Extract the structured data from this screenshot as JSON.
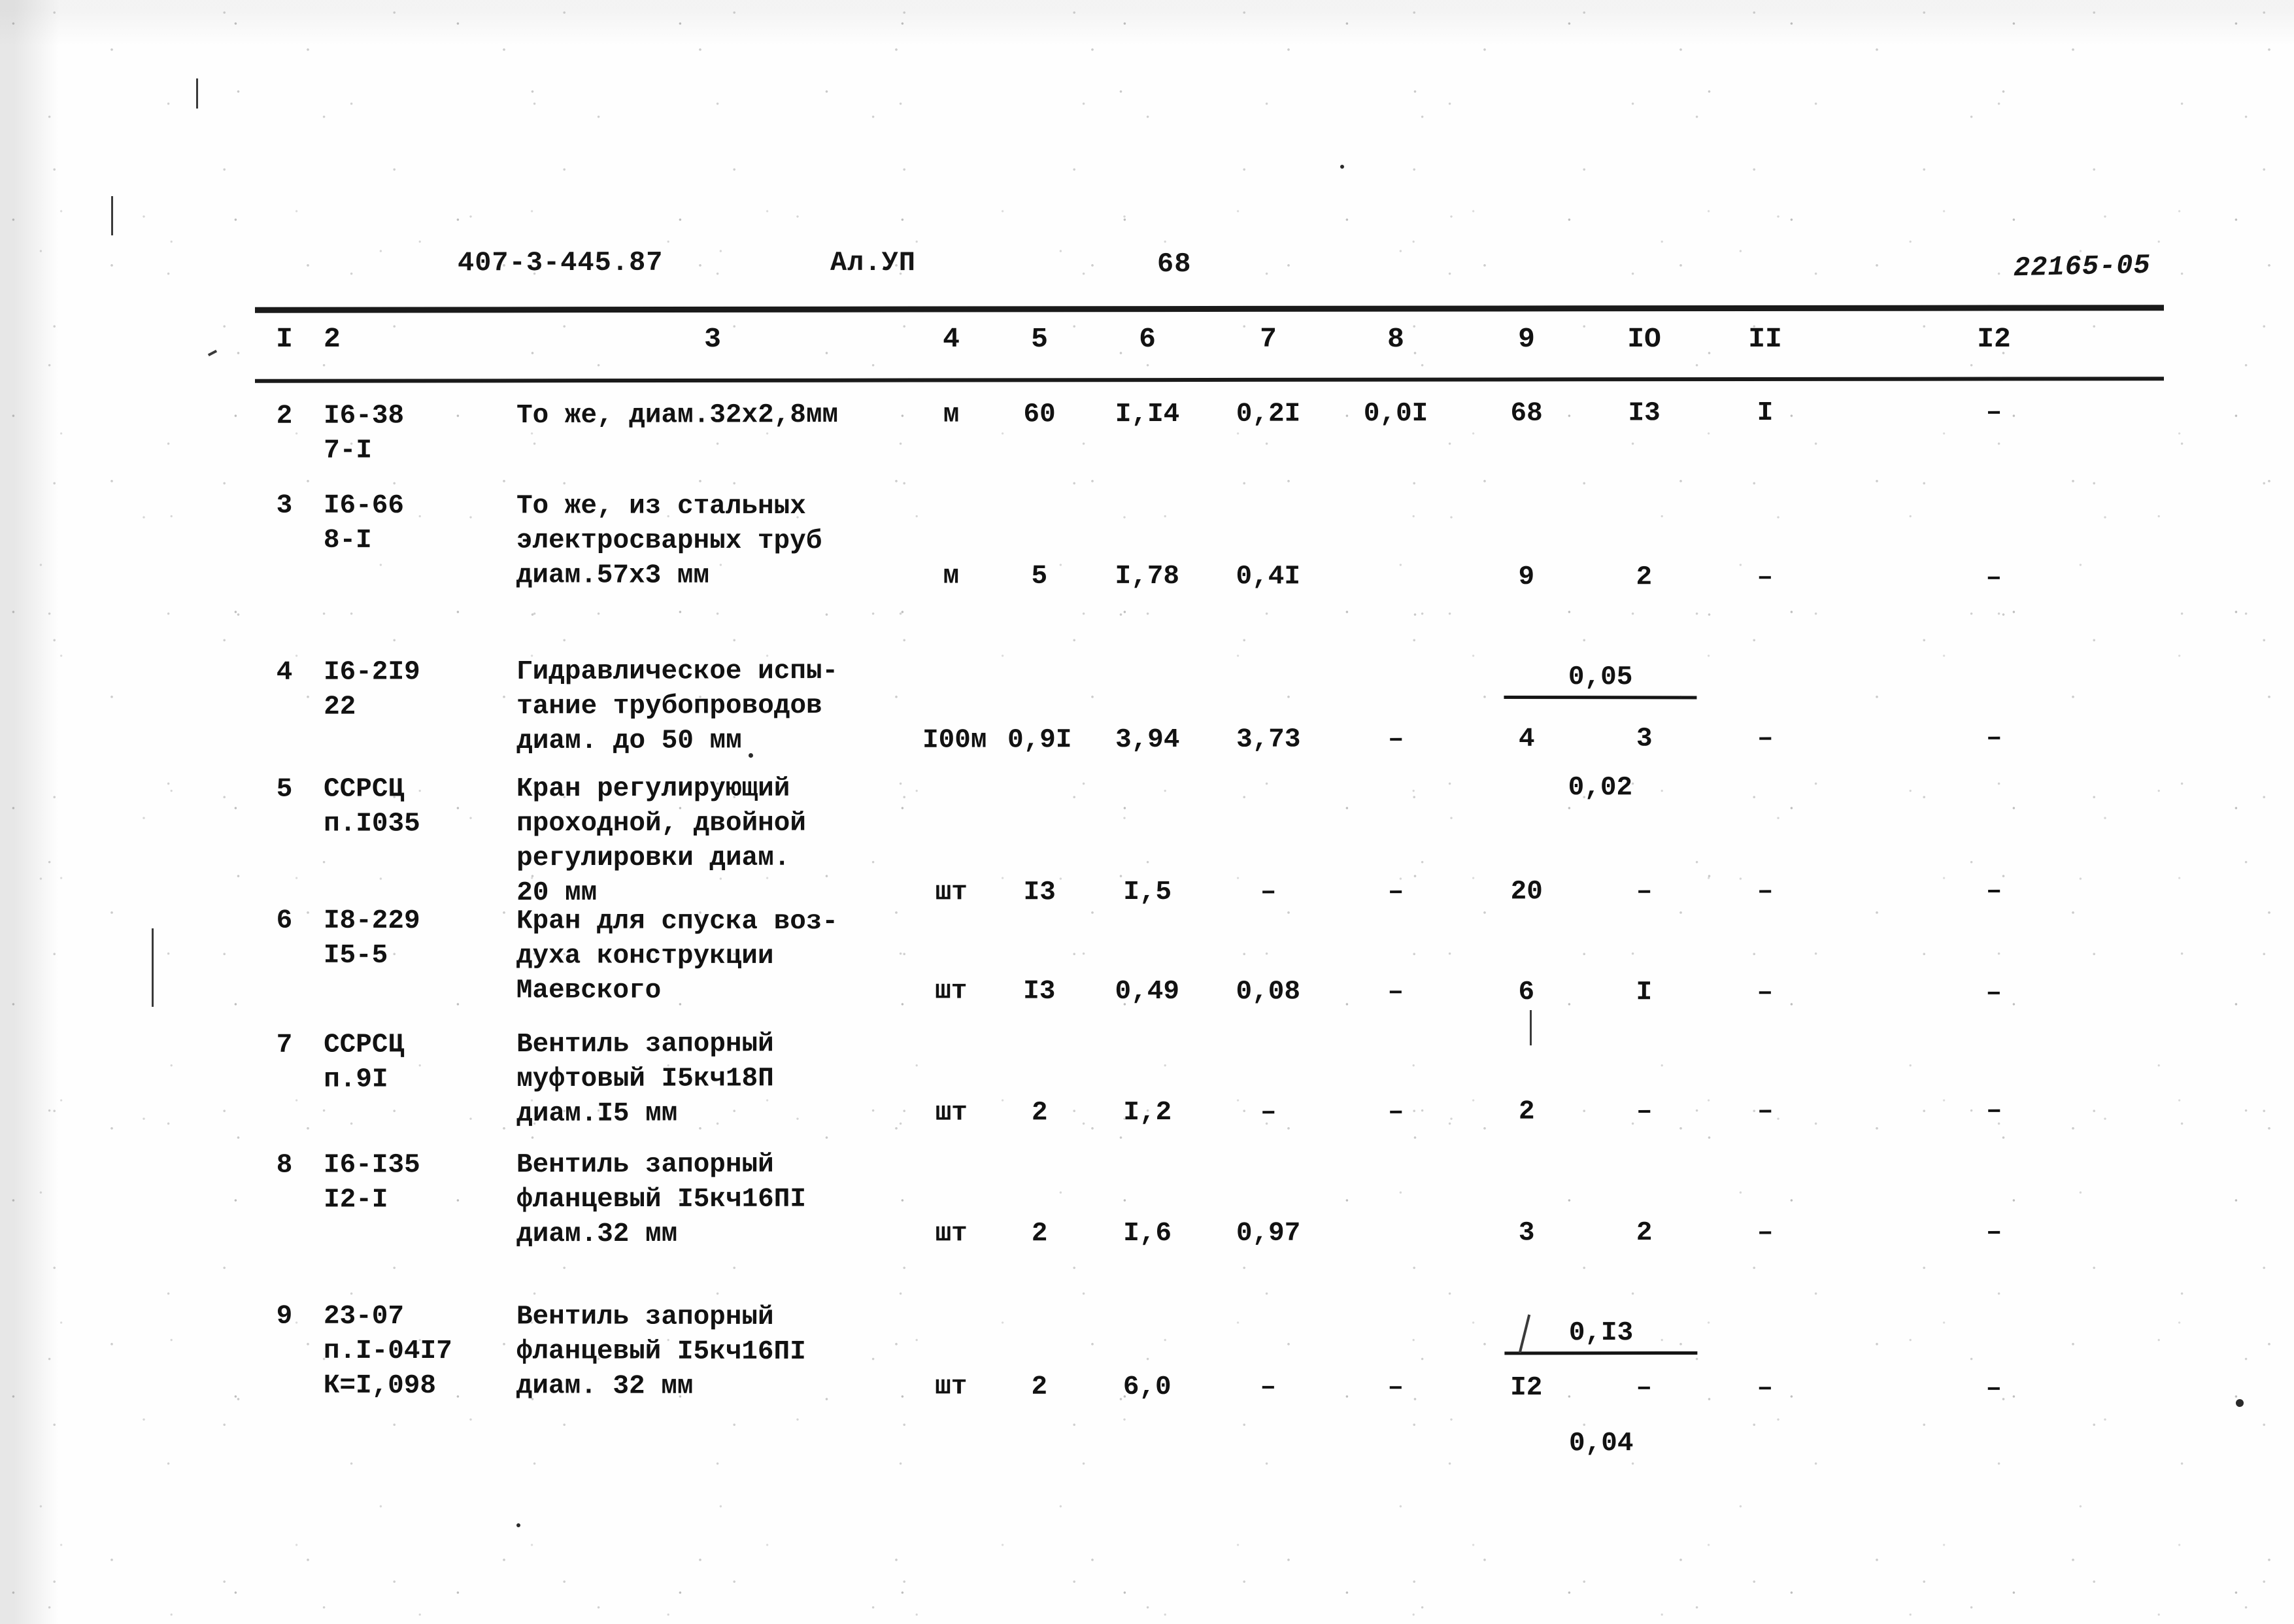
{
  "document": {
    "project_code": "407-3-445.87",
    "album": "Ал.УП",
    "page_number": "68",
    "archive_stamp": "22165-05"
  },
  "table": {
    "column_headers": [
      "I",
      "2",
      "3",
      "4",
      "5",
      "6",
      "7",
      "8",
      "9",
      "IO",
      "II",
      "I2"
    ],
    "rows": [
      {
        "no": "2",
        "code": "I6-38\n7-I",
        "name": "То же, диам.32х2,8мм",
        "unit": "м",
        "qty": "60",
        "c6": "I,I4",
        "c7": "0,2I",
        "c8": "0,0I",
        "c8_top": "",
        "c8_bot": "",
        "c9": "68",
        "c10": "I3",
        "c11": "I",
        "c12": "–"
      },
      {
        "no": "3",
        "code": "I6-66\n8-I",
        "name": "То же, из стальных\nэлектросварных труб\nдиам.57х3 мм",
        "unit": "м",
        "qty": "5",
        "c6": "I,78",
        "c7": "0,4I",
        "c8": "",
        "c8_top": "0,05",
        "c8_bot": "0,02",
        "c9": "9",
        "c10": "2",
        "c11": "–",
        "c12": "–"
      },
      {
        "no": "4",
        "code": "I6-2I9\n22",
        "name": "Гидравлическое испы-\nтание трубопроводов\nдиам. до 50 мм",
        "unit": "I00м",
        "qty": "0,9I",
        "c6": "3,94",
        "c7": "3,73",
        "c8": "–",
        "c8_top": "",
        "c8_bot": "",
        "c9": "4",
        "c10": "3",
        "c11": "–",
        "c12": "–"
      },
      {
        "no": "5",
        "code": "ССРСЦ\nп.I035",
        "name": "Кран регулирующий\nпроходной, двойной\nрегулировки диам.\n20 мм",
        "unit": "шт",
        "qty": "I3",
        "c6": "I,5",
        "c7": "–",
        "c8": "–",
        "c8_top": "",
        "c8_bot": "",
        "c9": "20",
        "c10": "–",
        "c11": "–",
        "c12": "–"
      },
      {
        "no": "6",
        "code": "I8-229\nI5-5",
        "name": "Кран для спуска воз-\nдуха конструкции\nМаевского",
        "unit": "шт",
        "qty": "I3",
        "c6": "0,49",
        "c7": "0,08",
        "c8": "–",
        "c8_top": "",
        "c8_bot": "",
        "c9": "6",
        "c10": "I",
        "c11": "–",
        "c12": "–"
      },
      {
        "no": "7",
        "code": "ССРСЦ\nп.9I",
        "name": "Вентиль запорный\nмуфтовый I5кч18П\nдиам.I5 мм",
        "unit": "шт",
        "qty": "2",
        "c6": "I,2",
        "c7": "–",
        "c8": "–",
        "c8_top": "",
        "c8_bot": "",
        "c9": "2",
        "c10": "–",
        "c11": "–",
        "c12": "–"
      },
      {
        "no": "8",
        "code": "I6-I35\nI2-I",
        "name": "Вентиль запорный\nфланцевый I5кч16ПI\nдиам.32 мм",
        "unit": "шт",
        "qty": "2",
        "c6": "I,6",
        "c7": "0,97",
        "c8": "",
        "c8_top": "0,I3",
        "c8_bot": "0,04",
        "c9": "3",
        "c10": "2",
        "c11": "–",
        "c12": "–"
      },
      {
        "no": "9",
        "code": "23-07\nп.I-04I7\nК=I,098",
        "name": "Вентиль запорный\nфланцевый I5кч16ПI\nдиам. 32 мм",
        "unit": "шт",
        "qty": "2",
        "c6": "6,0",
        "c7": "–",
        "c8": "–",
        "c8_top": "",
        "c8_bot": "",
        "c9": "I2",
        "c10": "–",
        "c11": "–",
        "c12": "–"
      }
    ]
  }
}
